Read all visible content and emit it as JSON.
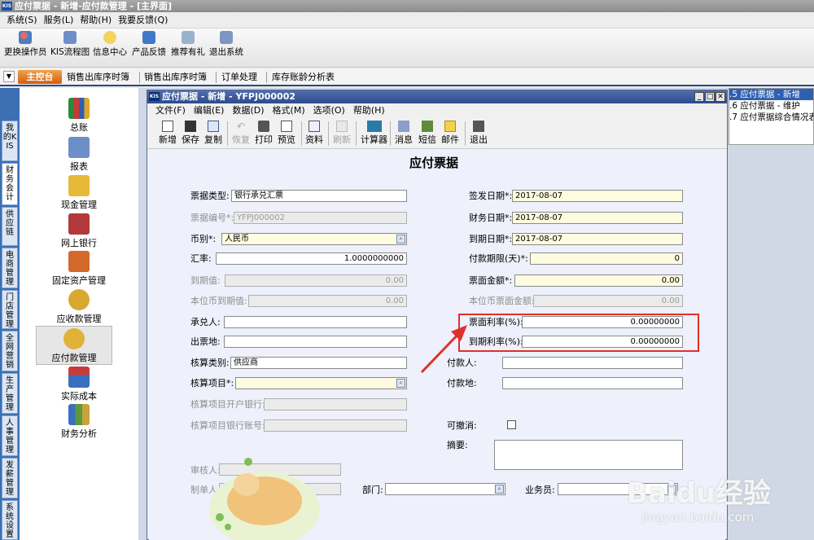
{
  "app": {
    "title": "应付票据 - 新增-应付款管理 - [主界面]",
    "icon": "KIS"
  },
  "menubar": [
    "系统(S)",
    "服务(L)",
    "帮助(H)",
    "我要反馈(Q)"
  ],
  "main_toolbar": [
    {
      "label": "更换操作员",
      "icon": "user-switch-icon"
    },
    {
      "label": "KIS流程图",
      "icon": "flowchart-icon"
    },
    {
      "label": "信息中心",
      "icon": "chat-icon"
    },
    {
      "label": "产品反馈",
      "icon": "feedback-icon"
    },
    {
      "label": "推荐有礼",
      "icon": "gift-icon"
    },
    {
      "label": "退出系统",
      "icon": "exit-icon"
    }
  ],
  "nav_tabs": {
    "home": "主控台",
    "tabs": [
      "销售出库序时簿",
      "销售出库序时簿",
      "订单处理",
      "库存账龄分析表"
    ]
  },
  "vertical_tabs": [
    "我的KIS",
    "财务会计",
    "供应链",
    "电商管理",
    "门店管理",
    "全网营销",
    "生产管理",
    "人事管理",
    "发薪管理",
    "系统设置"
  ],
  "side_items": [
    "总账",
    "报表",
    "现金管理",
    "网上银行",
    "固定资产管理",
    "应收款管理",
    "应付款管理",
    "实际成本",
    "财务分析"
  ],
  "right_list": [
    {
      "num": ".5",
      "text": "应付票据 - 新增"
    },
    {
      "num": ".6",
      "text": "应付票据 - 维护"
    },
    {
      "num": ".7",
      "text": "应付票据综合情况表"
    }
  ],
  "window": {
    "title": "应付票据 - 新增 - YFPJ000002",
    "menu": [
      "文件(F)",
      "编辑(E)",
      "数据(D)",
      "格式(M)",
      "选项(O)",
      "帮助(H)"
    ],
    "toolbar": [
      {
        "label": "新增",
        "icon": "new-icon",
        "enabled": true
      },
      {
        "label": "保存",
        "icon": "save-icon",
        "enabled": true
      },
      {
        "label": "复制",
        "icon": "copy-icon",
        "enabled": true
      },
      {
        "label": "恢复",
        "icon": "undo-icon",
        "enabled": false
      },
      {
        "label": "打印",
        "icon": "print-icon",
        "enabled": true
      },
      {
        "label": "预览",
        "icon": "preview-icon",
        "enabled": true
      },
      {
        "label": "资料",
        "icon": "data-icon",
        "enabled": true
      },
      {
        "label": "刷新",
        "icon": "refresh-icon",
        "enabled": false
      },
      {
        "label": "计算器",
        "icon": "calculator-icon",
        "enabled": true
      },
      {
        "label": "消息",
        "icon": "message-icon",
        "enabled": true
      },
      {
        "label": "短信",
        "icon": "sms-icon",
        "enabled": true
      },
      {
        "label": "邮件",
        "icon": "mail-icon",
        "enabled": true
      },
      {
        "label": "退出",
        "icon": "exit-icon",
        "enabled": true
      }
    ]
  },
  "form": {
    "title": "应付票据",
    "bill_type": {
      "label": "票据类型:",
      "value": "银行承兑汇票"
    },
    "bill_no": {
      "label": "票据编号*:",
      "value": "YFPJ000002"
    },
    "currency": {
      "label": "币别*:",
      "value": "人民币"
    },
    "rate": {
      "label": "汇率:",
      "value": "1.0000000000"
    },
    "maturity_value": {
      "label": "到期值:",
      "value": "0.00"
    },
    "local_maturity_value": {
      "label": "本位币到期值:",
      "value": "0.00"
    },
    "acceptor": {
      "label": "承兑人:",
      "value": ""
    },
    "issue_place": {
      "label": "出票地:",
      "value": ""
    },
    "acct_category": {
      "label": "核算类别:",
      "value": "供应商"
    },
    "acct_item": {
      "label": "核算项目*:",
      "value": ""
    },
    "acct_bank": {
      "label": "核算项目开户银行:",
      "value": ""
    },
    "acct_bank_no": {
      "label": "核算项目银行账号:",
      "value": ""
    },
    "issue_date": {
      "label": "签发日期*:",
      "value": "2017-08-07"
    },
    "finance_date": {
      "label": "财务日期*:",
      "value": "2017-08-07"
    },
    "due_date": {
      "label": "到期日期*:",
      "value": "2017-08-07"
    },
    "term": {
      "label": "付款期限(天)*:",
      "value": "0"
    },
    "face_amount": {
      "label": "票面金额*:",
      "value": "0.00"
    },
    "local_face_amount": {
      "label": "本位币票面金额:",
      "value": "0.00"
    },
    "face_rate": {
      "label": "票面利率(%):",
      "value": "0.00000000"
    },
    "due_rate": {
      "label": "到期利率(%):",
      "value": "0.00000000"
    },
    "payee": {
      "label": "付款人:",
      "value": ""
    },
    "pay_place": {
      "label": "付款地:",
      "value": ""
    },
    "revocable": {
      "label": "可撤消:",
      "checked": false
    },
    "summary": {
      "label": "摘要:",
      "value": ""
    },
    "reviewer": {
      "label": "审核人:",
      "value": ""
    },
    "maker": {
      "label": "制单人:",
      "value": ""
    },
    "dept": {
      "label": "部门:",
      "value": ""
    },
    "salesman": {
      "label": "业务员:",
      "value": ""
    }
  },
  "watermark": {
    "line1": "Baidu经验",
    "line2": "jingyan.baidu.com"
  },
  "colors": {
    "highlight": "#e0302a",
    "title_bar": "#2d4b8c",
    "required_bg": "#fdfbe0"
  }
}
